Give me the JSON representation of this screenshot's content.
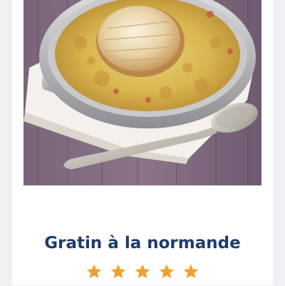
{
  "recipe": {
    "title": "Gratin à la normande",
    "image": {
      "subject": "gratin-dish-photo"
    },
    "rating": {
      "value": 5,
      "max": 5
    }
  },
  "colors": {
    "title": "#1f3c6a",
    "star": "#f2a127",
    "background": "#eef0f3",
    "card": "#ffffff"
  }
}
